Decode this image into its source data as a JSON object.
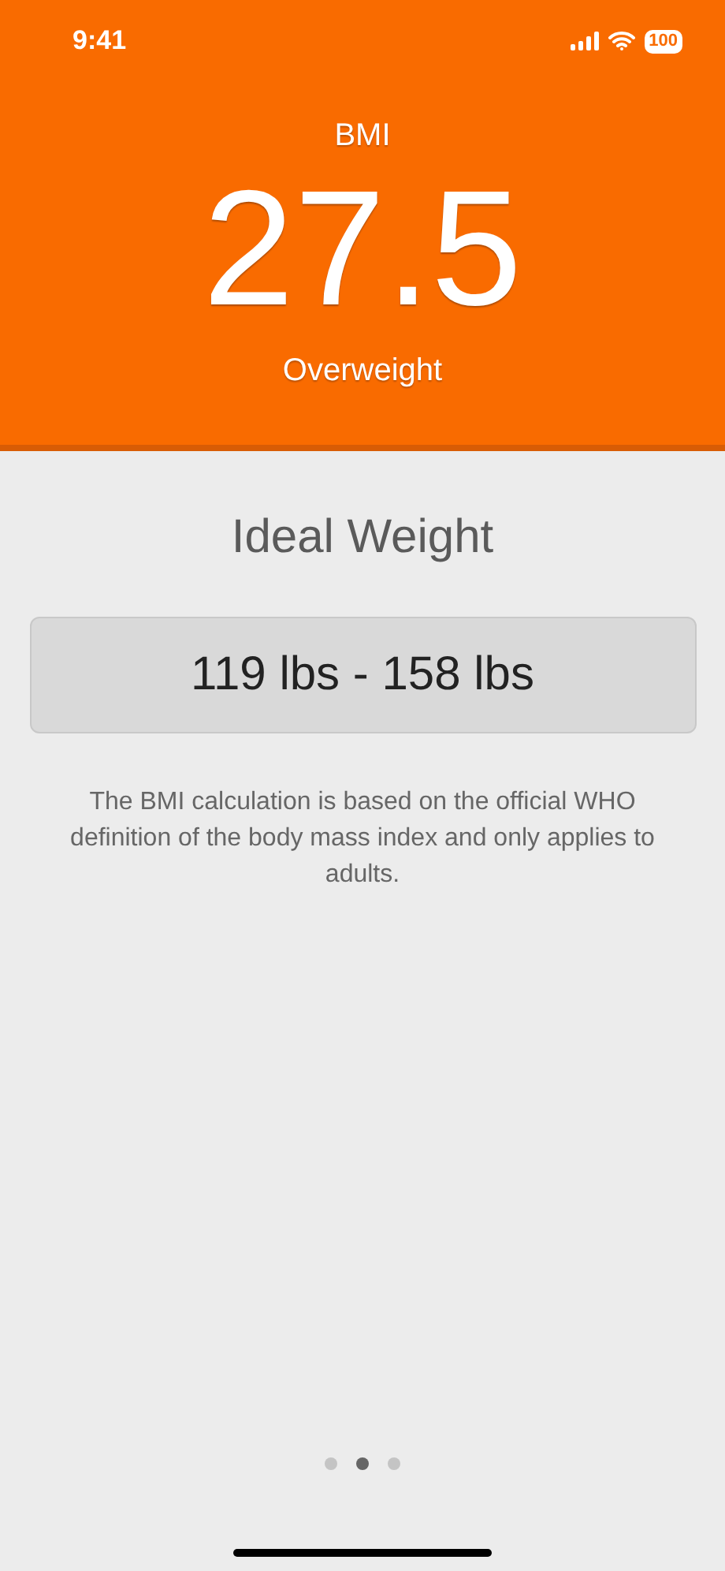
{
  "status_bar": {
    "time": "9:41",
    "battery": "100"
  },
  "header": {
    "label": "BMI",
    "value": "27.5",
    "category": "Overweight"
  },
  "ideal_weight": {
    "title": "Ideal Weight",
    "range": "119 lbs - 158 lbs"
  },
  "note": "The BMI calculation is based on the official WHO definition of the body mass index and only applies to adults.",
  "pages": [
    {
      "selected": false
    },
    {
      "selected": true
    },
    {
      "selected": false
    }
  ]
}
